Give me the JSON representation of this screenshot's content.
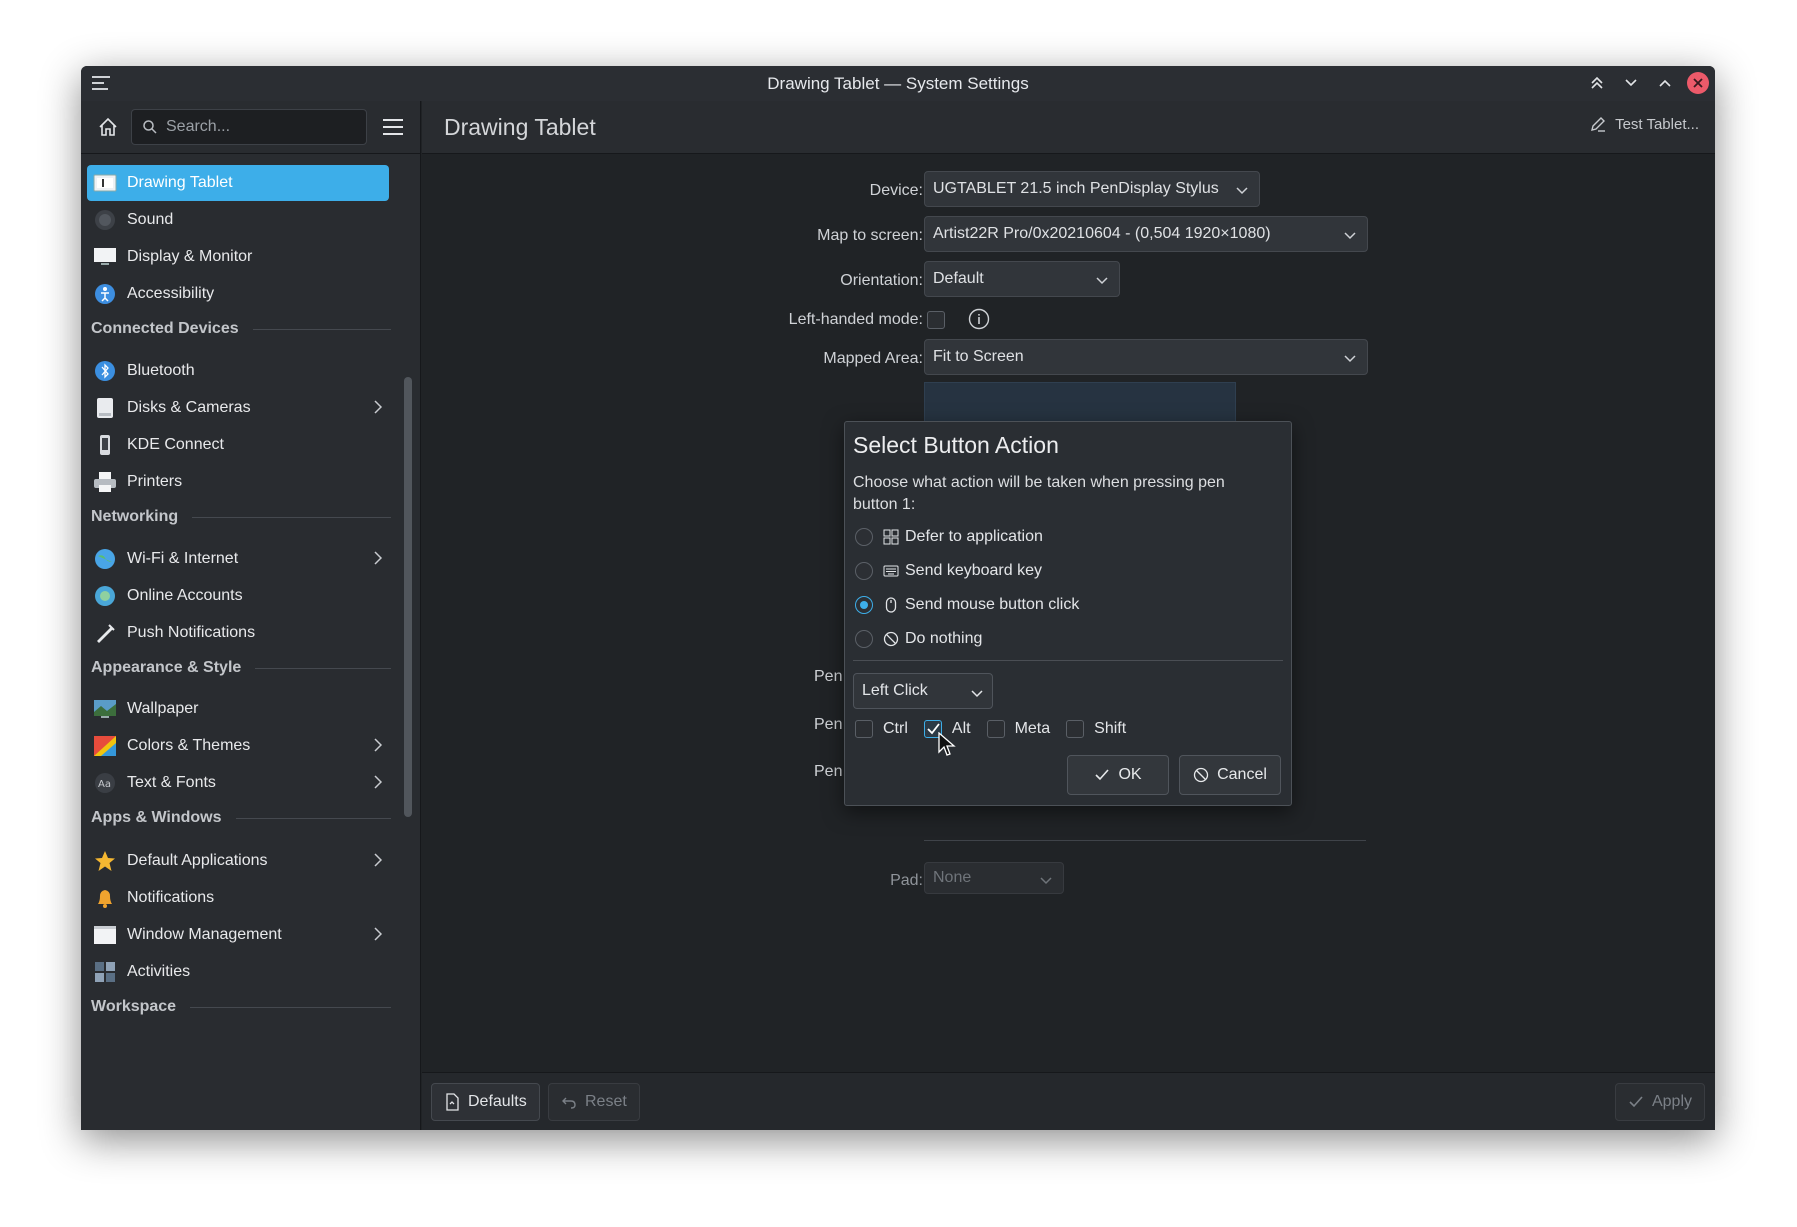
{
  "window": {
    "title": "Drawing Tablet — System Settings"
  },
  "sidebar": {
    "search_placeholder": "Search...",
    "items": [
      {
        "label": "Drawing Tablet",
        "icon": "tablet-icon",
        "active": true
      },
      {
        "label": "Sound",
        "icon": "speaker-icon"
      },
      {
        "label": "Display & Monitor",
        "icon": "monitor-icon"
      },
      {
        "label": "Accessibility",
        "icon": "accessibility-icon"
      },
      {
        "label": "Bluetooth",
        "icon": "bluetooth-icon"
      },
      {
        "label": "Disks & Cameras",
        "icon": "disk-icon",
        "has_children": true
      },
      {
        "label": "KDE Connect",
        "icon": "phone-icon"
      },
      {
        "label": "Printers",
        "icon": "printer-icon"
      },
      {
        "label": "Wi-Fi & Internet",
        "icon": "globe-icon",
        "has_children": true
      },
      {
        "label": "Online Accounts",
        "icon": "accounts-icon"
      },
      {
        "label": "Push Notifications",
        "icon": "push-icon"
      },
      {
        "label": "Wallpaper",
        "icon": "wallpaper-icon"
      },
      {
        "label": "Colors & Themes",
        "icon": "palette-icon",
        "has_children": true
      },
      {
        "label": "Text & Fonts",
        "icon": "font-icon",
        "has_children": true
      },
      {
        "label": "Default Applications",
        "icon": "star-icon",
        "has_children": true
      },
      {
        "label": "Notifications",
        "icon": "bell-icon"
      },
      {
        "label": "Window Management",
        "icon": "window-icon",
        "has_children": true
      },
      {
        "label": "Activities",
        "icon": "activities-icon"
      }
    ],
    "sections": [
      "Connected Devices",
      "Networking",
      "Appearance & Style",
      "Apps & Windows",
      "Workspace"
    ]
  },
  "main": {
    "heading": "Drawing Tablet",
    "test_button": "Test Tablet...",
    "device_label": "Device:",
    "device_value": "UGTABLET 21.5 inch PenDisplay Stylus",
    "map_label": "Map to screen:",
    "map_value": "Artist22R Pro/0x20210604 - (0,504 1920×1080)",
    "orientation_label": "Orientation:",
    "orientation_value": "Default",
    "lefthanded_label": "Left-handed mode:",
    "mapped_area_label": "Mapped Area:",
    "mapped_area_value": "Fit to Screen",
    "pen_labels": [
      "Pen",
      "Pen",
      "Pen"
    ],
    "pad_label": "Pad:",
    "pad_value": "None"
  },
  "footer": {
    "defaults": "Defaults",
    "reset": "Reset",
    "apply": "Apply"
  },
  "dialog": {
    "title": "Select Button Action",
    "description": "Choose what action will be taken when pressing pen button 1:",
    "options": [
      {
        "label": "Defer to application",
        "selected": false
      },
      {
        "label": "Send keyboard key",
        "selected": false
      },
      {
        "label": "Send mouse button click",
        "selected": true
      },
      {
        "label": "Do nothing",
        "selected": false
      }
    ],
    "mouse_button": "Left Click",
    "modifiers": [
      {
        "label": "Ctrl",
        "checked": false
      },
      {
        "label": "Alt",
        "checked": true
      },
      {
        "label": "Meta",
        "checked": false
      },
      {
        "label": "Shift",
        "checked": false
      }
    ],
    "ok": "OK",
    "cancel": "Cancel"
  },
  "colors": {
    "accent": "#3daee9",
    "window_bg": "#202326",
    "close_button": "#ed5a6a"
  }
}
